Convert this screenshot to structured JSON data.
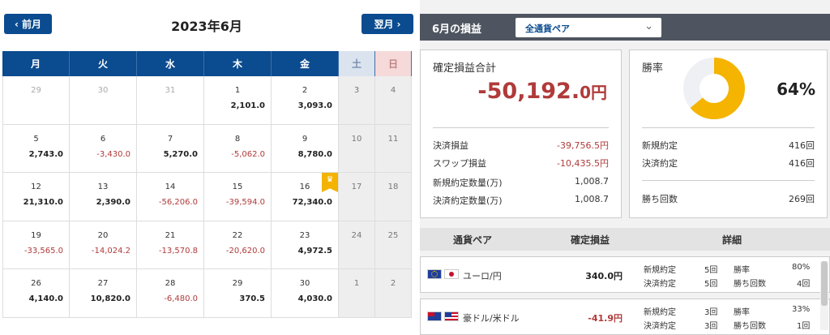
{
  "nav": {
    "prev_label": "前月",
    "next_label": "翌月",
    "month_title": "2023年6月"
  },
  "weekdays": [
    "月",
    "火",
    "水",
    "木",
    "金",
    "土",
    "日"
  ],
  "weeks": [
    [
      {
        "d": "29",
        "v": "",
        "out": true
      },
      {
        "d": "30",
        "v": "",
        "out": true
      },
      {
        "d": "31",
        "v": "",
        "out": true
      },
      {
        "d": "1",
        "v": "2,101.0"
      },
      {
        "d": "2",
        "v": "3,093.0"
      },
      {
        "d": "3",
        "v": ""
      },
      {
        "d": "4",
        "v": ""
      }
    ],
    [
      {
        "d": "5",
        "v": "2,743.0"
      },
      {
        "d": "6",
        "v": "-3,430.0",
        "neg": true
      },
      {
        "d": "7",
        "v": "5,270.0"
      },
      {
        "d": "8",
        "v": "-5,062.0",
        "neg": true
      },
      {
        "d": "9",
        "v": "8,780.0"
      },
      {
        "d": "10",
        "v": ""
      },
      {
        "d": "11",
        "v": ""
      }
    ],
    [
      {
        "d": "12",
        "v": "21,310.0"
      },
      {
        "d": "13",
        "v": "2,390.0"
      },
      {
        "d": "14",
        "v": "-56,206.0",
        "neg": true
      },
      {
        "d": "15",
        "v": "-39,594.0",
        "neg": true
      },
      {
        "d": "16",
        "v": "72,340.0",
        "crown": true
      },
      {
        "d": "17",
        "v": ""
      },
      {
        "d": "18",
        "v": ""
      }
    ],
    [
      {
        "d": "19",
        "v": "-33,565.0",
        "neg": true
      },
      {
        "d": "20",
        "v": "-14,024.2",
        "neg": true
      },
      {
        "d": "21",
        "v": "-13,570.8",
        "neg": true
      },
      {
        "d": "22",
        "v": "-20,620.0",
        "neg": true
      },
      {
        "d": "23",
        "v": "4,972.5"
      },
      {
        "d": "24",
        "v": ""
      },
      {
        "d": "25",
        "v": ""
      }
    ],
    [
      {
        "d": "26",
        "v": "4,140.0"
      },
      {
        "d": "27",
        "v": "10,820.0"
      },
      {
        "d": "28",
        "v": "-6,480.0",
        "neg": true
      },
      {
        "d": "29",
        "v": "370.5"
      },
      {
        "d": "30",
        "v": "4,030.0"
      },
      {
        "d": "1",
        "v": "",
        "out": true
      },
      {
        "d": "2",
        "v": "",
        "out": true
      }
    ]
  ],
  "summary": {
    "header_title": "6月の損益",
    "pair_select": "全通貨ペア",
    "pl_label": "確定損益合計",
    "pl_total": "-50,192.",
    "pl_total_dec": "0円",
    "rows": [
      {
        "label": "決済損益",
        "value": "-39,756.5円",
        "neg": true
      },
      {
        "label": "スワップ損益",
        "value": "-10,435.5円",
        "neg": true
      },
      {
        "label": "新規約定数量(万)",
        "value": "1,008.7"
      },
      {
        "label": "決済約定数量(万)",
        "value": "1,008.7"
      }
    ],
    "win_label": "勝率",
    "win_rate_text": "64%",
    "win_rate": 0.64,
    "win_rows": [
      {
        "label": "新規約定",
        "value": "416回"
      },
      {
        "label": "決済約定",
        "value": "416回"
      },
      {
        "label": "勝ち回数",
        "value": "269回"
      }
    ]
  },
  "table": {
    "headers": [
      "通貨ペア",
      "確定損益",
      "詳細"
    ],
    "rows": [
      {
        "pair": "ユーロ/円",
        "amount": "340.0円",
        "neg": false,
        "new_label": "新規約定",
        "new": "5回",
        "settle_label": "決済約定",
        "settle": "5回",
        "win_label": "勝率",
        "win": "80%",
        "wins_label": "勝ち回数",
        "wins": "4回"
      },
      {
        "pair": "豪ドル/米ドル",
        "amount": "-41.9円",
        "neg": true,
        "new_label": "新規約定",
        "new": "3回",
        "settle_label": "決済約定",
        "settle": "3回",
        "win_label": "勝率",
        "win": "33%",
        "wins_label": "勝ち回数",
        "wins": "1回"
      }
    ]
  },
  "colors": {
    "accent": "#0b4b8f",
    "negative": "#b03a3a",
    "donut": "#f5b400",
    "donut_bg": "#eef0f4"
  }
}
